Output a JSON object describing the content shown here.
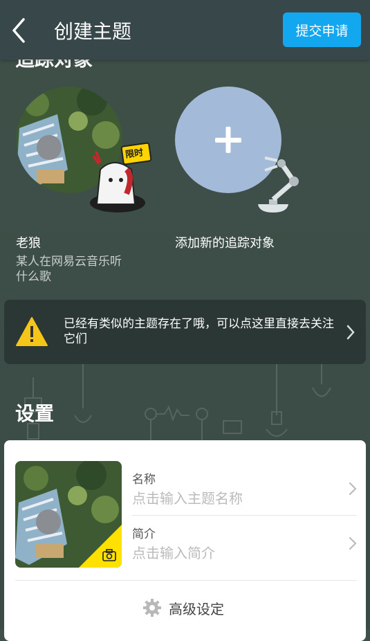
{
  "header": {
    "title": "创建主题",
    "submit_label": "提交申请"
  },
  "tracking": {
    "section_title": "追踪对象",
    "targets": [
      {
        "name": "老狼",
        "description": "某人在网易云音乐听什么歌",
        "badge": "限时"
      }
    ],
    "add_label": "添加新的追踪对象"
  },
  "notice": {
    "text": "已经有类似的主题存在了哦，可以点这里直接去关注它们"
  },
  "settings": {
    "section_title": "设置",
    "name_label": "名称",
    "name_placeholder": "点击输入主题名称",
    "intro_label": "简介",
    "intro_placeholder": "点击输入简介",
    "advanced_label": "高级设定"
  },
  "colors": {
    "accent": "#12a7ee",
    "warning": "#f5c518",
    "add_circle": "#a3bad9"
  }
}
